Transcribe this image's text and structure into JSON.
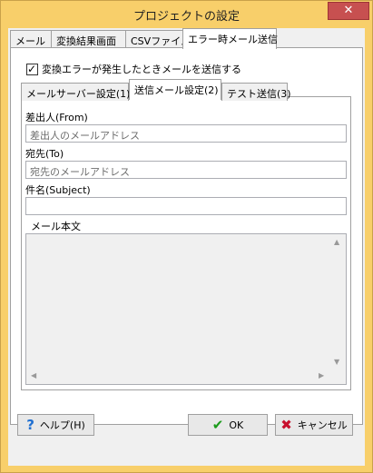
{
  "window": {
    "title": "プロジェクトの設定",
    "close_glyph": "✕"
  },
  "tabs": [
    {
      "label": "メール"
    },
    {
      "label": "変換結果画面"
    },
    {
      "label": "CSVファイル"
    },
    {
      "label": "エラー時メール送信"
    }
  ],
  "send_on_error": {
    "label": "変換エラーが発生したときメールを送信する",
    "checked": true
  },
  "subtabs": [
    {
      "label": "メールサーバー設定(1)"
    },
    {
      "label": "送信メール設定(2)"
    },
    {
      "label": "テスト送信(3)"
    }
  ],
  "form": {
    "from_label": "差出人(From)",
    "from_value": "差出人のメールアドレス",
    "to_label": "宛先(To)",
    "to_value": "宛先のメールアドレス",
    "subject_label": "件名(Subject)",
    "subject_value": "",
    "body_label": "メール本文",
    "body_value": ""
  },
  "buttons": {
    "help": "ヘルプ(H)",
    "ok": "OK",
    "cancel": "キャンセル"
  },
  "icons": {
    "help_icon": "?",
    "ok_icon": "✔",
    "cancel_icon": "✖",
    "help_color": "#1f6fd1",
    "ok_color": "#1a9b1a",
    "cancel_color": "#c8102e"
  }
}
